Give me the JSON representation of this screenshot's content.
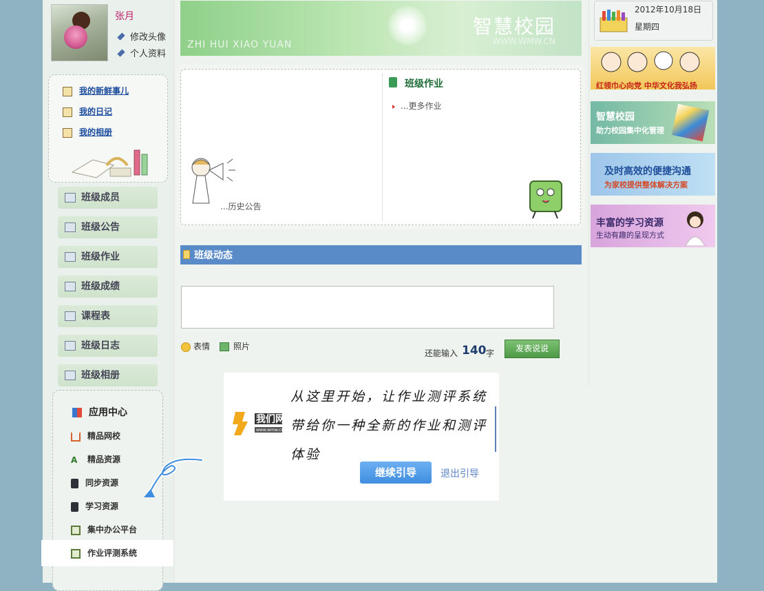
{
  "profile": {
    "name": "张月",
    "edit_avatar": "修改头像",
    "personal_info": "个人资料"
  },
  "quick_links": [
    {
      "label": "我的新鲜事儿",
      "icon": "news-icon"
    },
    {
      "label": "我的日记",
      "icon": "diary-icon"
    },
    {
      "label": "我的相册",
      "icon": "album-icon"
    }
  ],
  "side_menu": [
    {
      "label": "班级成员",
      "icon": "members-icon"
    },
    {
      "label": "班级公告",
      "icon": "announcement-icon"
    },
    {
      "label": "班级作业",
      "icon": "homework-icon"
    },
    {
      "label": "班级成绩",
      "icon": "grades-icon"
    },
    {
      "label": "课程表",
      "icon": "calendar-icon"
    },
    {
      "label": "班级日志",
      "icon": "log-icon"
    },
    {
      "label": "班级相册",
      "icon": "photo-album-icon"
    }
  ],
  "app_center": {
    "title": "应用中心",
    "items": [
      {
        "label": "精品网校",
        "icon": "home-icon"
      },
      {
        "label": "精品资源",
        "icon": "resource-icon"
      },
      {
        "label": "同步资源",
        "icon": "device-icon"
      },
      {
        "label": "学习资源",
        "icon": "device-icon"
      },
      {
        "label": "集中办公平台",
        "icon": "book-icon"
      },
      {
        "label": "作业评测系统",
        "icon": "book-icon"
      }
    ]
  },
  "banner": {
    "title": "智慧校园",
    "pinyin": "ZHI HUI XIAO YUAN",
    "url": "WWW.WMW.CN"
  },
  "board": {
    "homework_title": "班级作业",
    "more_homework": "...更多作业",
    "history_notice": "...历史公告"
  },
  "dynamics": {
    "title": "班级动态",
    "emoji_label": "表情",
    "photo_label": "照片",
    "remaining_prefix": "还能输入",
    "remaining_count": "140",
    "remaining_unit": "字",
    "post_button": "发表说说"
  },
  "date": {
    "date": "2012年10月18日",
    "weekday": "星期四"
  },
  "ads": [
    {
      "line1": "红领巾心向党 中华文化我弘扬",
      "line2": ""
    },
    {
      "line1": "智慧校园",
      "line2": "助力校园集中化管理"
    },
    {
      "line1": "及时高效的便捷沟通",
      "line2": "为家校提供整体解决方案"
    },
    {
      "line1": "丰富的学习资源",
      "line2": "生动有趣的呈现方式"
    }
  ],
  "guide": {
    "message": "从这里开始，让作业测评系统带给你一种全新的作业和测评体验",
    "logo_text": "我们网",
    "logo_url": "www.wmw.cn",
    "continue_button": "继续引导",
    "exit_link": "退出引导"
  },
  "colors": {
    "accent_blue": "#5a8bc9",
    "post_green": "#4c9a45",
    "name_pink": "#c0206a",
    "continue_blue": "#3f8de0"
  }
}
